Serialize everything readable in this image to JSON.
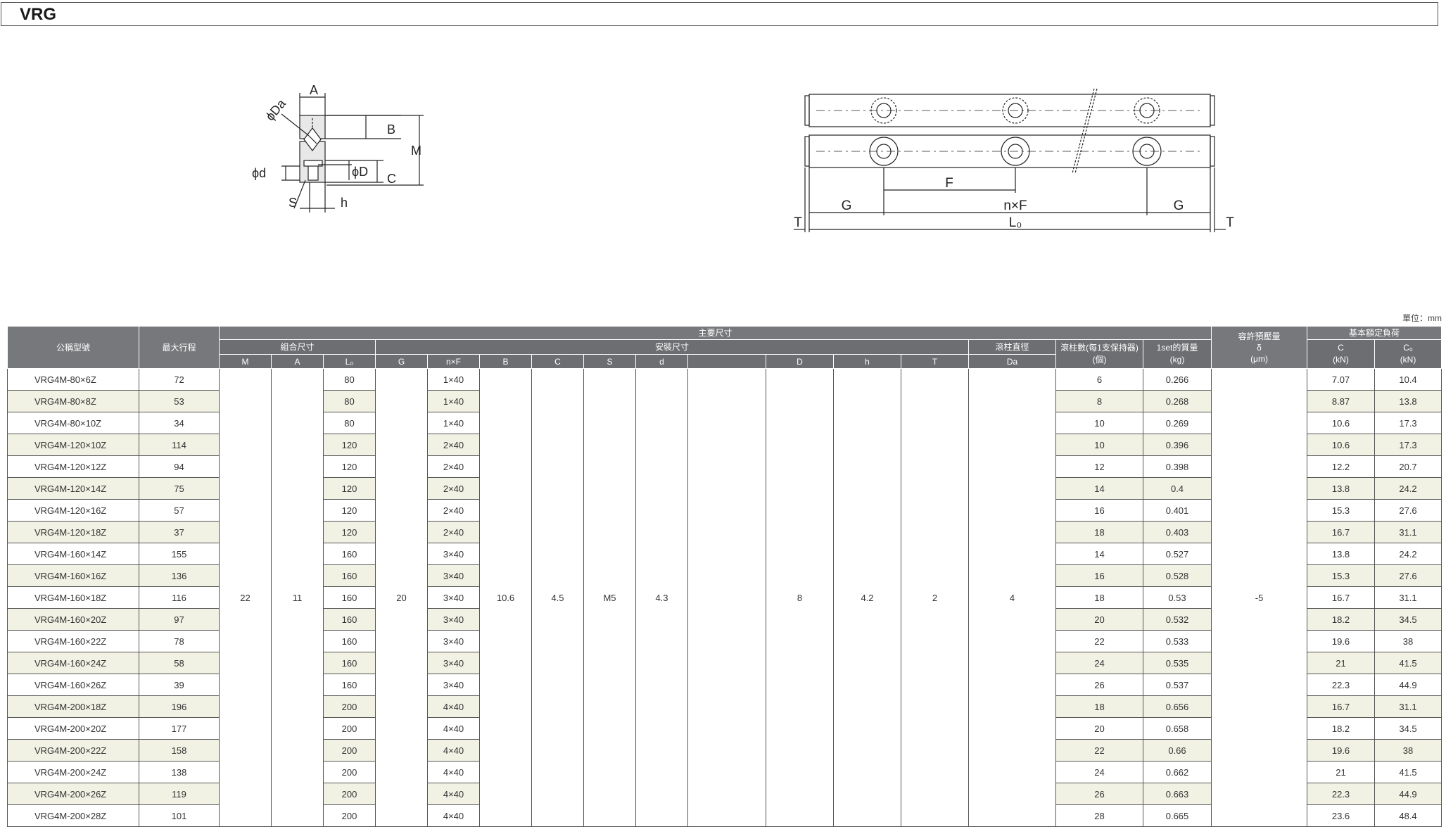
{
  "title": "VRG",
  "unit": "單位：mm",
  "left_drawing": {
    "labels": {
      "A": "A",
      "Da": "ϕDa",
      "B": "B",
      "M": "M",
      "d": "ϕd",
      "D": "ϕD",
      "C": "C",
      "S": "S",
      "h": "h"
    }
  },
  "right_drawing": {
    "labels": {
      "F": "F",
      "G_left": "G",
      "nF": "n×F",
      "G_right": "G",
      "T_left": "T",
      "L0": "L₀",
      "T_right": "T"
    }
  },
  "table": {
    "headers": {
      "model": "公稱型號",
      "max_stroke": "最大行程",
      "main_dims": "主要尺寸",
      "assembly_dims": "組合尺寸",
      "mounting_dims": "安裝尺寸",
      "roller_dia_line1": "滾柱直徑",
      "roller_count_line1": "滾柱數(每1支保持器)",
      "roller_count_line2": "(個)",
      "mass_line1": "1set的質量",
      "mass_line2": "(kg)",
      "preload_line1": "容許預壓量",
      "preload_line2": "δ",
      "preload_line3": "(μm)",
      "load_rating": "基本額定負荷",
      "C_line1": "C",
      "C_line2": "(kN)",
      "C0_line1": "C₀",
      "C0_line2": "(kN)",
      "col_M": "M",
      "col_A": "A",
      "col_L0": "L₀",
      "col_G": "G",
      "col_nF": "n×F",
      "col_B": "B",
      "col_C": "C",
      "col_S": "S",
      "col_d": "d",
      "col_blank": "",
      "col_D": "D",
      "col_h": "h",
      "col_T": "T",
      "col_Da": "Da"
    },
    "common": {
      "M": "22",
      "A": "11",
      "G": "20",
      "B": "10.6",
      "C": "4.5",
      "S": "M5",
      "d": "4.3",
      "blank": "",
      "D": "8",
      "h": "4.2",
      "T": "2",
      "Da": "4",
      "preload": "-5"
    },
    "rows": [
      {
        "model": "VRG4M-80×6Z",
        "stroke": "72",
        "L0": "80",
        "nF": "1×40",
        "rollers": "6",
        "mass": "0.266",
        "C": "7.07",
        "C0": "10.4"
      },
      {
        "model": "VRG4M-80×8Z",
        "stroke": "53",
        "L0": "80",
        "nF": "1×40",
        "rollers": "8",
        "mass": "0.268",
        "C": "8.87",
        "C0": "13.8"
      },
      {
        "model": "VRG4M-80×10Z",
        "stroke": "34",
        "L0": "80",
        "nF": "1×40",
        "rollers": "10",
        "mass": "0.269",
        "C": "10.6",
        "C0": "17.3"
      },
      {
        "model": "VRG4M-120×10Z",
        "stroke": "114",
        "L0": "120",
        "nF": "2×40",
        "rollers": "10",
        "mass": "0.396",
        "C": "10.6",
        "C0": "17.3"
      },
      {
        "model": "VRG4M-120×12Z",
        "stroke": "94",
        "L0": "120",
        "nF": "2×40",
        "rollers": "12",
        "mass": "0.398",
        "C": "12.2",
        "C0": "20.7"
      },
      {
        "model": "VRG4M-120×14Z",
        "stroke": "75",
        "L0": "120",
        "nF": "2×40",
        "rollers": "14",
        "mass": "0.4",
        "C": "13.8",
        "C0": "24.2"
      },
      {
        "model": "VRG4M-120×16Z",
        "stroke": "57",
        "L0": "120",
        "nF": "2×40",
        "rollers": "16",
        "mass": "0.401",
        "C": "15.3",
        "C0": "27.6"
      },
      {
        "model": "VRG4M-120×18Z",
        "stroke": "37",
        "L0": "120",
        "nF": "2×40",
        "rollers": "18",
        "mass": "0.403",
        "C": "16.7",
        "C0": "31.1"
      },
      {
        "model": "VRG4M-160×14Z",
        "stroke": "155",
        "L0": "160",
        "nF": "3×40",
        "rollers": "14",
        "mass": "0.527",
        "C": "13.8",
        "C0": "24.2"
      },
      {
        "model": "VRG4M-160×16Z",
        "stroke": "136",
        "L0": "160",
        "nF": "3×40",
        "rollers": "16",
        "mass": "0.528",
        "C": "15.3",
        "C0": "27.6"
      },
      {
        "model": "VRG4M-160×18Z",
        "stroke": "116",
        "L0": "160",
        "nF": "3×40",
        "rollers": "18",
        "mass": "0.53",
        "C": "16.7",
        "C0": "31.1"
      },
      {
        "model": "VRG4M-160×20Z",
        "stroke": "97",
        "L0": "160",
        "nF": "3×40",
        "rollers": "20",
        "mass": "0.532",
        "C": "18.2",
        "C0": "34.5"
      },
      {
        "model": "VRG4M-160×22Z",
        "stroke": "78",
        "L0": "160",
        "nF": "3×40",
        "rollers": "22",
        "mass": "0.533",
        "C": "19.6",
        "C0": "38"
      },
      {
        "model": "VRG4M-160×24Z",
        "stroke": "58",
        "L0": "160",
        "nF": "3×40",
        "rollers": "24",
        "mass": "0.535",
        "C": "21",
        "C0": "41.5"
      },
      {
        "model": "VRG4M-160×26Z",
        "stroke": "39",
        "L0": "160",
        "nF": "3×40",
        "rollers": "26",
        "mass": "0.537",
        "C": "22.3",
        "C0": "44.9"
      },
      {
        "model": "VRG4M-200×18Z",
        "stroke": "196",
        "L0": "200",
        "nF": "4×40",
        "rollers": "18",
        "mass": "0.656",
        "C": "16.7",
        "C0": "31.1"
      },
      {
        "model": "VRG4M-200×20Z",
        "stroke": "177",
        "L0": "200",
        "nF": "4×40",
        "rollers": "20",
        "mass": "0.658",
        "C": "18.2",
        "C0": "34.5"
      },
      {
        "model": "VRG4M-200×22Z",
        "stroke": "158",
        "L0": "200",
        "nF": "4×40",
        "rollers": "22",
        "mass": "0.66",
        "C": "19.6",
        "C0": "38"
      },
      {
        "model": "VRG4M-200×24Z",
        "stroke": "138",
        "L0": "200",
        "nF": "4×40",
        "rollers": "24",
        "mass": "0.662",
        "C": "21",
        "C0": "41.5"
      },
      {
        "model": "VRG4M-200×26Z",
        "stroke": "119",
        "L0": "200",
        "nF": "4×40",
        "rollers": "26",
        "mass": "0.663",
        "C": "22.3",
        "C0": "44.9"
      },
      {
        "model": "VRG4M-200×28Z",
        "stroke": "101",
        "L0": "200",
        "nF": "4×40",
        "rollers": "28",
        "mass": "0.665",
        "C": "23.6",
        "C0": "48.4"
      }
    ]
  }
}
